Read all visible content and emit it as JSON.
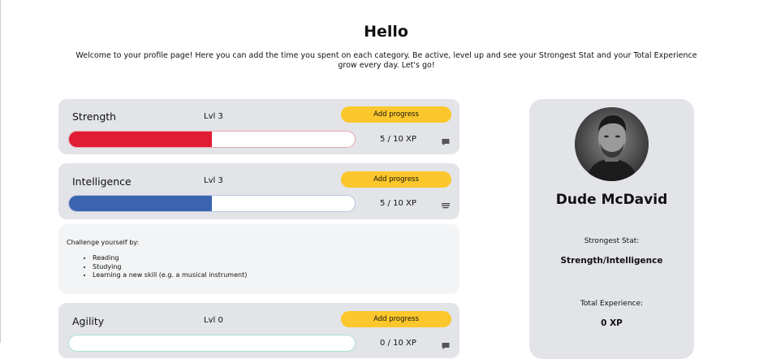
{
  "header": {
    "title": "Hello",
    "intro": "Welcome to your profile page! Here you can add the time you spent on each category. Be active, level up and see your Strongest Stat and your Total Experience grow every day. Let's go!"
  },
  "stats": [
    {
      "name": "Strength",
      "level": "Lvl 3",
      "add_label": "Add progress",
      "xp": "5 / 10 XP",
      "progress": 0.5,
      "color": "#e01b34",
      "icon": "comment-icon"
    },
    {
      "name": "Intelligence",
      "level": "Lvl 3",
      "add_label": "Add progress",
      "xp": "5 / 10 XP",
      "progress": 0.5,
      "color": "#3a64b0",
      "icon": "menu-lines-icon"
    },
    {
      "name": "Agility",
      "level": "Lvl 0",
      "add_label": "Add progress",
      "xp": "0 / 10 XP",
      "progress": 0,
      "color": "#5cc2b0",
      "icon": "comment-icon"
    }
  ],
  "challenge": {
    "title": "Challenge yourself by:",
    "items": [
      "Reading",
      "Studying",
      "Learning a new skill (e.g. a musical instrument)"
    ]
  },
  "profile": {
    "name": "Dude McDavid",
    "strongest_label": "Strongest Stat:",
    "strongest_value": "Strength/Intelligence",
    "total_label": "Total Experience:",
    "total_value": "0 XP"
  },
  "colors": {
    "accent": "#fcc72c",
    "card": "#e2e4e8",
    "strength": "#e01b34",
    "intelligence": "#3a64b0",
    "agility": "#5cc2b0"
  }
}
